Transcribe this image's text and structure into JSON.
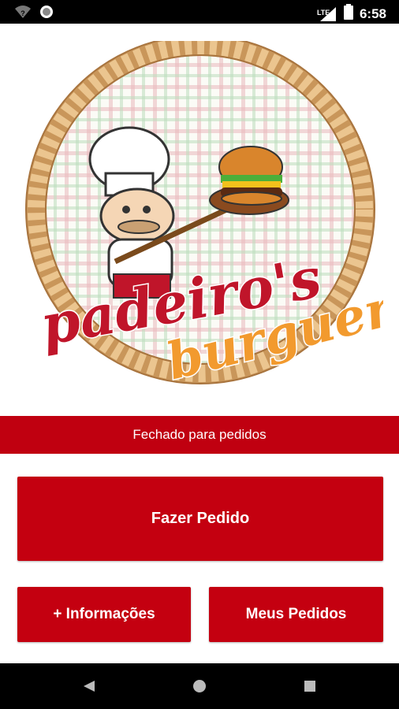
{
  "status_bar": {
    "time": "6:58",
    "network_label": "LTE",
    "icons": [
      "wifi-icon",
      "notification-dot-icon",
      "signal-icon",
      "battery-icon"
    ]
  },
  "logo": {
    "text_line1": "padeiro's",
    "text_line2": "burguer",
    "colors": {
      "rope": "#c9965a",
      "primary_text": "#c0152a",
      "secondary_text": "#f29a2e"
    }
  },
  "store_status": {
    "label": "Fechado para pedidos"
  },
  "actions": {
    "order_label": "Fazer Pedido",
    "info_label": "+ Informações",
    "my_orders_label": "Meus Pedidos"
  },
  "theme": {
    "primary": "#c40010",
    "status_bar_bg": "#000000"
  },
  "nav_bar": {
    "icons": [
      "back-icon",
      "home-icon",
      "recents-icon"
    ]
  }
}
